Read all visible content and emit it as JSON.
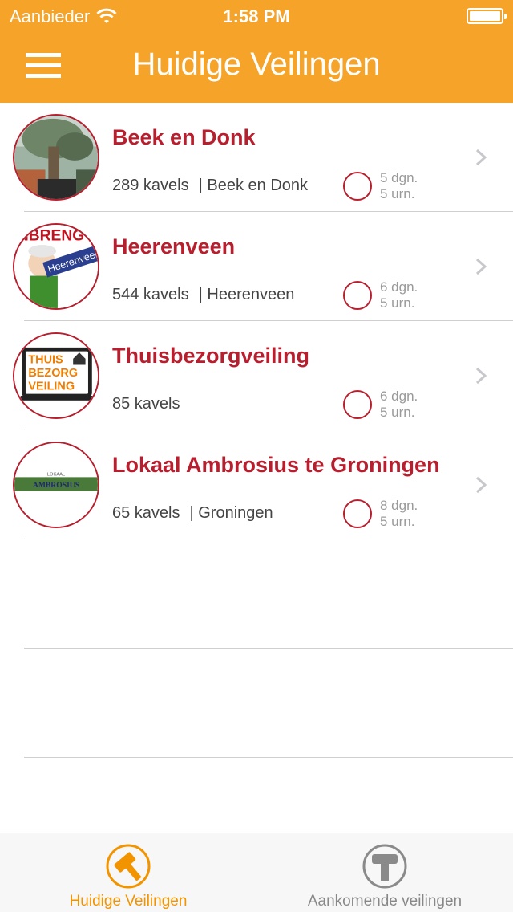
{
  "status_bar": {
    "carrier": "Aanbieder",
    "time": "1:58 PM"
  },
  "header": {
    "title": "Huidige Veilingen",
    "menu_icon": "hamburger-icon"
  },
  "colors": {
    "accent": "#f5a329",
    "title_red": "#b71f2e",
    "tab_active": "#f29300"
  },
  "auctions": [
    {
      "title": "Beek en Donk",
      "lots": "289 kavels",
      "location": "| Beek en Donk",
      "days": "5 dgn.",
      "hours": "5 urn."
    },
    {
      "title": "Heerenveen",
      "lots": "544 kavels",
      "location": "| Heerenveen",
      "days": "6 dgn.",
      "hours": "5 urn."
    },
    {
      "title": "Thuisbezorgveiling",
      "lots": "85 kavels",
      "location": "",
      "days": "6 dgn.",
      "hours": "5 urn."
    },
    {
      "title": "Lokaal Ambrosius te Groningen",
      "lots": "65 kavels",
      "location": "| Groningen",
      "days": "8 dgn.",
      "hours": "5 urn."
    }
  ],
  "logos": {
    "heerenveen_banner": "Heerenveen",
    "heerenveen_top": "NBRENG",
    "thuis_line1": "THUIS",
    "thuis_line2": "BEZORG",
    "thuis_line3": "VEILING",
    "lokaal_top": "LOKAAL",
    "lokaal_main": "AMBROSIUS"
  },
  "tabbar": {
    "tabs": [
      {
        "label": "Huidige Veilingen",
        "icon": "gavel-icon",
        "active": true
      },
      {
        "label": "Aankomende veilingen",
        "icon": "hammer-icon",
        "active": false
      }
    ]
  }
}
